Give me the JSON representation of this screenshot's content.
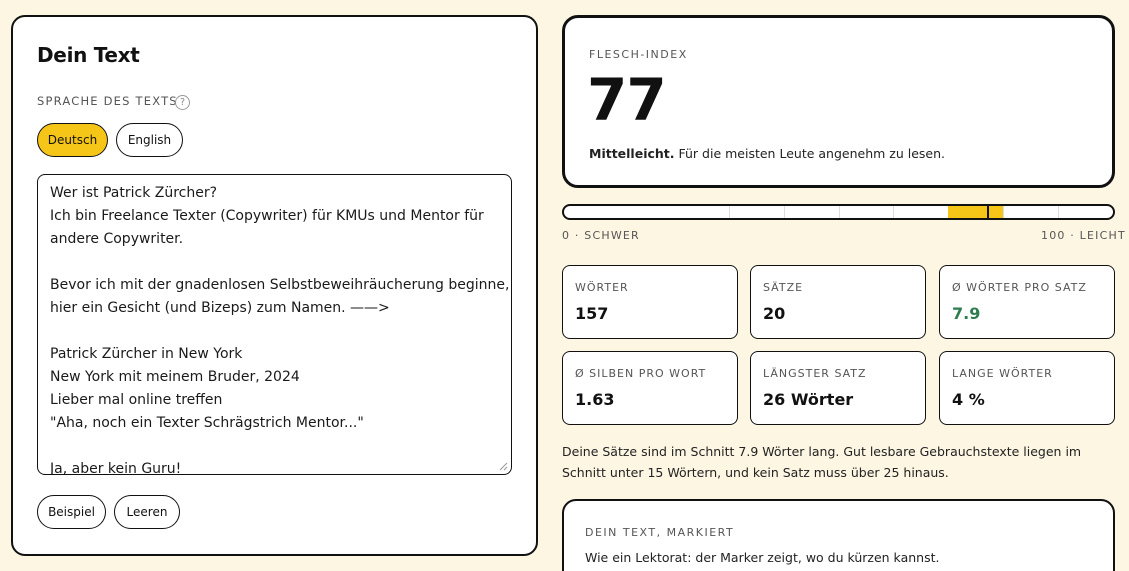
{
  "editor": {
    "title": "Dein Text",
    "language_label": "SPRACHE DES TEXTS",
    "help_glyph": "?",
    "languages": [
      {
        "label": "Deutsch",
        "active": true
      },
      {
        "label": "English",
        "active": false
      }
    ],
    "text_lines": [
      "Wer ist Patrick Zürcher?",
      "Ich bin Freelance Texter (Copywriter) für KMUs und Mentor für",
      "andere Copywriter.",
      "",
      "Bevor ich mit der gnadenlosen Selbstbeweihräucherung beginne,",
      "hier ein Gesicht (und Bizeps) zum Namen. ——>",
      "",
      "Patrick Zürcher in New York",
      "New York mit meinem Bruder, 2024",
      "Lieber mal online treffen",
      "\"Aha, noch ein Texter Schrägstrich Mentor...\"",
      "",
      "Ja, aber kein Guru!"
    ],
    "example_button": "Beispiel",
    "clear_button": "Leeren"
  },
  "flesch": {
    "label": "FLESCH-INDEX",
    "score": "77",
    "verdict_strong": "Mittelleicht.",
    "verdict_text": " Für die meisten Leute angenehm zu lesen."
  },
  "scale": {
    "value": 77,
    "min_label": "0 · SCHWER",
    "max_label": "100 · LEICHT",
    "accent": "#f5c518"
  },
  "stats": [
    {
      "label": "WÖRTER",
      "value": "157"
    },
    {
      "label": "SÄTZE",
      "value": "20"
    },
    {
      "label": "Ø WÖRTER PRO SATZ",
      "value": "7.9",
      "highlight": "#2e7d4f"
    },
    {
      "label": "Ø SILBEN PRO WORT",
      "value": "1.63"
    },
    {
      "label": "LÄNGSTER SATZ",
      "value": "26 Wörter"
    },
    {
      "label": "LANGE WÖRTER",
      "value": "4 %"
    }
  ],
  "note": "Deine Sätze sind im Schnitt 7.9 Wörter lang. Gut lesbare Gebrauchstexte liegen im Schnitt unter 15 Wörtern, und kein Satz muss über 25 hinaus.",
  "marked": {
    "label": "DEIN TEXT, MARKIERT",
    "subtitle": "Wie ein Lektorat: der Marker zeigt, wo du kürzen kannst."
  }
}
